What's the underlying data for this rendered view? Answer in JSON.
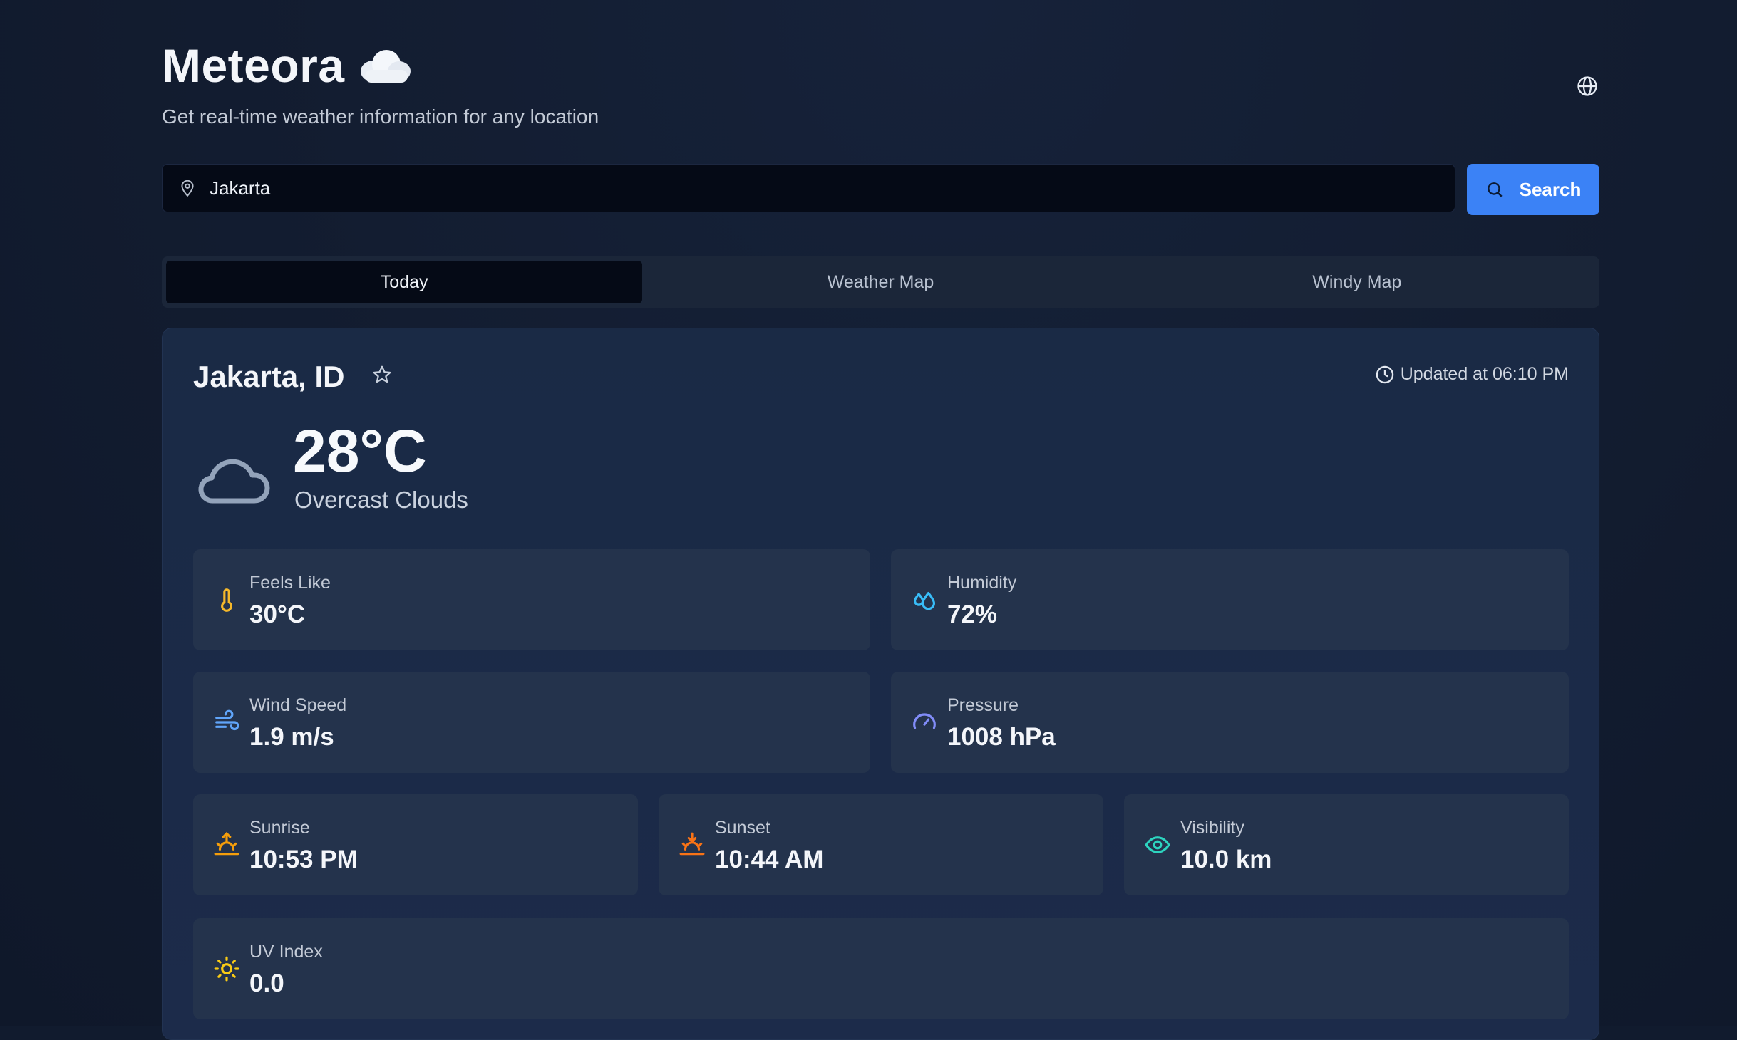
{
  "app": {
    "title": "Meteora",
    "title_icon": "cloud-icon",
    "subtitle": "Get real-time weather information for any location",
    "language_icon": "globe-icon"
  },
  "search": {
    "value": "Jakarta",
    "button_label": "Search",
    "location_icon": "map-pin-icon",
    "button_icon": "search-icon"
  },
  "tabs": [
    {
      "label": "Today",
      "active": true
    },
    {
      "label": "Weather Map",
      "active": false
    },
    {
      "label": "Windy Map",
      "active": false
    }
  ],
  "weather": {
    "city": "Jakarta, ID",
    "updated": "Updated at 06:10 PM",
    "temperature": "28°C",
    "description": "Overcast Clouds",
    "stats": {
      "feels_like": {
        "label": "Feels Like",
        "value": "30°C",
        "icon": "thermometer-icon",
        "color": "#f5b82a"
      },
      "humidity": {
        "label": "Humidity",
        "value": "72%",
        "icon": "droplets-icon",
        "color": "#38bdf8"
      },
      "wind_speed": {
        "label": "Wind Speed",
        "value": "1.9 m/s",
        "icon": "wind-icon",
        "color": "#60a5fa"
      },
      "pressure": {
        "label": "Pressure",
        "value": "1008 hPa",
        "icon": "gauge-icon",
        "color": "#818cf8"
      },
      "sunrise": {
        "label": "Sunrise",
        "value": "10:53 PM",
        "icon": "sunrise-icon",
        "color": "#f59e0b"
      },
      "sunset": {
        "label": "Sunset",
        "value": "10:44 AM",
        "icon": "sunset-icon",
        "color": "#f97316"
      },
      "visibility": {
        "label": "Visibility",
        "value": "10.0 km",
        "icon": "eye-icon",
        "color": "#2dd4bf"
      },
      "uv_index": {
        "label": "UV Index",
        "value": "0.0",
        "icon": "sun-icon",
        "color": "#facc15"
      }
    }
  },
  "colors": {
    "accent": "#3b82f6",
    "background": "#111b2e",
    "card": "#1b2a48",
    "stat_card": "#24334c"
  }
}
